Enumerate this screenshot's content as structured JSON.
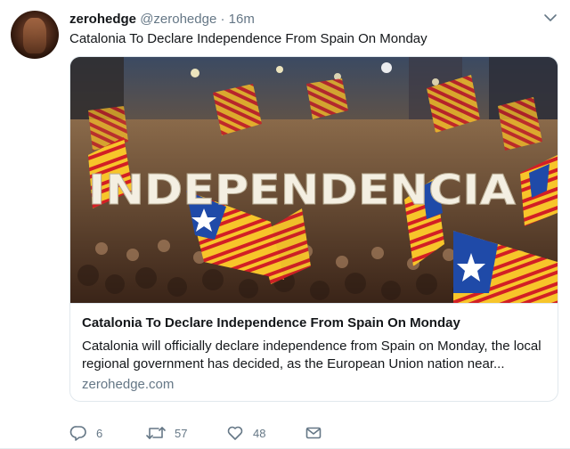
{
  "tweet": {
    "display_name": "zerohedge",
    "handle": "@zerohedge",
    "separator": "·",
    "time": "16m",
    "text": "Catalonia To Declare Independence From Spain On Monday"
  },
  "card": {
    "image_text": "INDEPENDENCIA",
    "title": "Catalonia To Declare Independence From Spain On Monday",
    "description": "Catalonia will officially declare independence from Spain on Monday, the local regional government has decided, as the European Union nation near...",
    "domain": "zerohedge.com"
  },
  "actions": {
    "reply_count": "6",
    "retweet_count": "57",
    "like_count": "48"
  },
  "icons": {
    "caret": "chevron-down-icon",
    "reply": "reply-icon",
    "retweet": "retweet-icon",
    "like": "heart-icon",
    "message": "envelope-icon"
  },
  "colors": {
    "text": "#14171a",
    "secondary": "#657786",
    "border": "#e1e8ed",
    "estelada_yellow": "#f7c52a",
    "estelada_red": "#d21f25",
    "estelada_blue": "#1f4aa8"
  }
}
